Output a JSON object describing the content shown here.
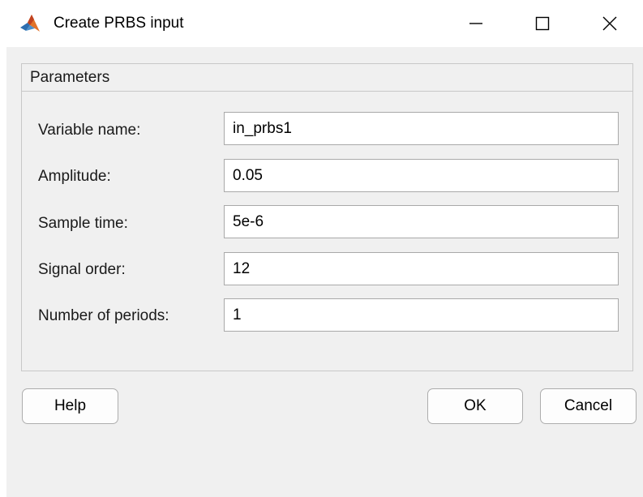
{
  "window": {
    "title": "Create PRBS input",
    "controls": {
      "minimize_icon": "minimize-icon",
      "maximize_icon": "maximize-icon",
      "close_icon": "close-icon"
    }
  },
  "parameters": {
    "group_title": "Parameters",
    "fields": [
      {
        "label": "Variable name:",
        "value": "in_prbs1"
      },
      {
        "label": "Amplitude:",
        "value": "0.05"
      },
      {
        "label": "Sample time:",
        "value": "5e-6"
      },
      {
        "label": "Signal order:",
        "value": "12"
      },
      {
        "label": "Number of periods:",
        "value": "1"
      }
    ]
  },
  "buttons": {
    "help": "Help",
    "ok": "OK",
    "cancel": "Cancel"
  },
  "colors": {
    "dialog_background": "#f0f0f0",
    "title_bar": "#ffffff",
    "field_border": "#a9a9a9"
  }
}
